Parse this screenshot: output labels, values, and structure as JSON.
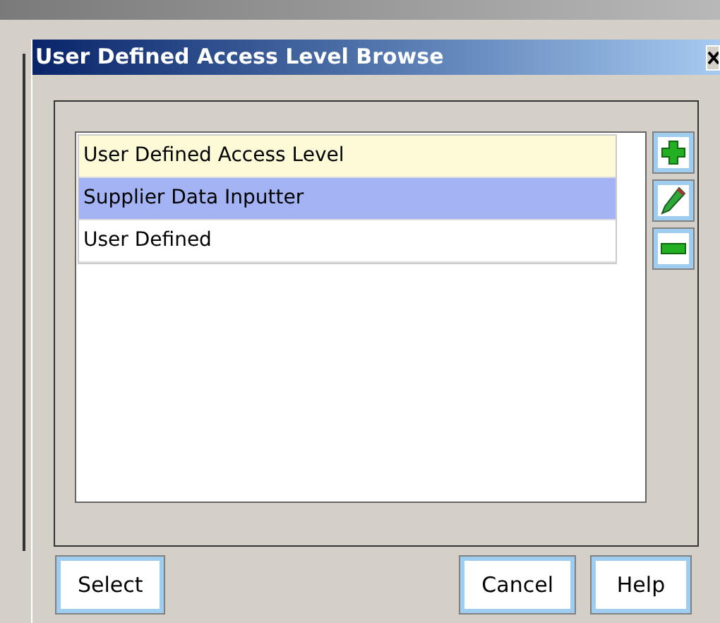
{
  "window": {
    "title": "User Defined Access Level Browse"
  },
  "list": {
    "rows": [
      {
        "kind": "header",
        "label": "User Defined Access Level",
        "selected": false
      },
      {
        "kind": "item",
        "label": "Supplier Data Inputter",
        "selected": true
      },
      {
        "kind": "item",
        "label": "User Defined",
        "selected": false
      }
    ]
  },
  "side_buttons": [
    {
      "kind": "add"
    },
    {
      "kind": "edit"
    },
    {
      "kind": "remove"
    }
  ],
  "left_buttons": [
    "Select"
  ],
  "right_buttons": [
    "Cancel",
    "Help"
  ]
}
